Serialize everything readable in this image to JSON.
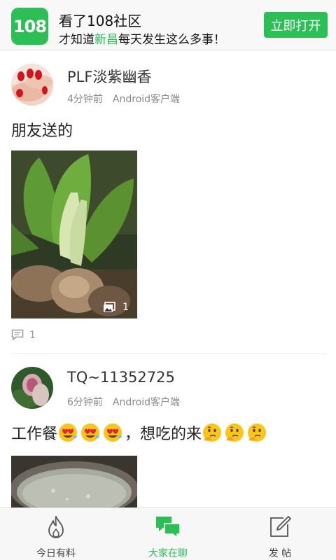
{
  "banner": {
    "logo_text": "108",
    "title": "看了108社区",
    "subtitle_prefix": "才知道",
    "subtitle_highlight": "新昌",
    "subtitle_suffix": "每天发生这么多事！",
    "open_button": "立即打开"
  },
  "posts": [
    {
      "username": "PLF淡紫幽香",
      "time": "4分钟前",
      "client": "Android客户端",
      "content": "朋友送的",
      "image_count": "1",
      "comment_count": "1"
    },
    {
      "username": "TQ~11352725",
      "time": "6分钟前",
      "client": "Android客户端",
      "content_prefix": "工作餐",
      "content_middle": "，想吃的来",
      "emoji_before": [
        "heart-eyes",
        "heart-eyes",
        "heart-eyes"
      ],
      "emoji_after": [
        "thinking",
        "thinking",
        "thinking"
      ]
    }
  ],
  "nav": {
    "items": [
      {
        "label": "今日有料",
        "icon": "flame-icon",
        "active": false
      },
      {
        "label": "大家在聊",
        "icon": "chat-bubbles-icon",
        "active": true
      },
      {
        "label": "发 帖",
        "icon": "edit-icon",
        "active": false
      }
    ]
  },
  "colors": {
    "accent": "#2bbf55",
    "meta_text": "#8a8a8a"
  }
}
